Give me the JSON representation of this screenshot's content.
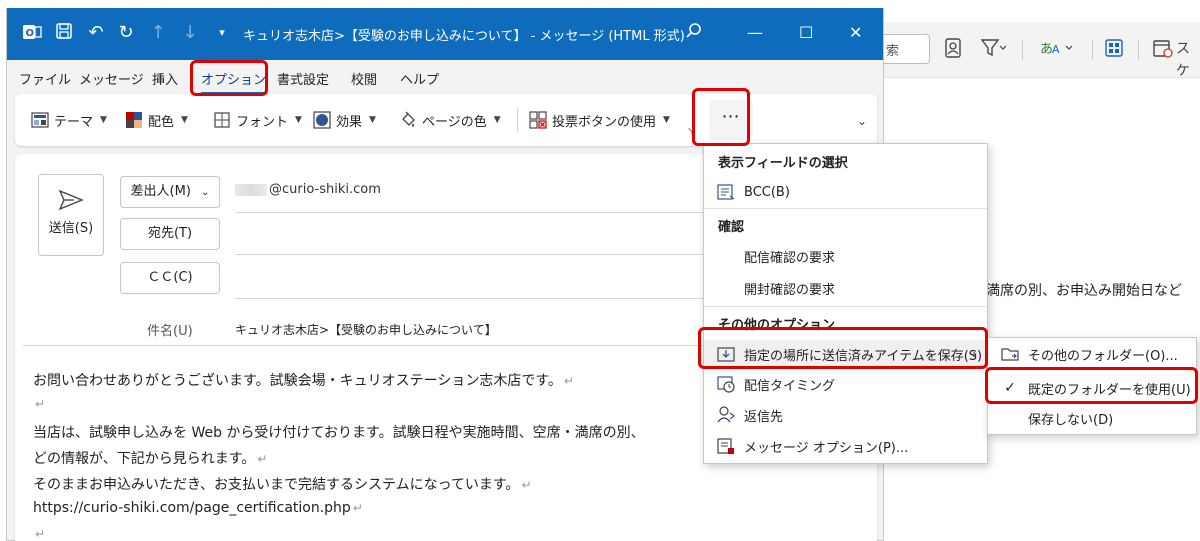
{
  "window": {
    "title": "キュリオ志木店>【受験のお申し込みについて】 - メッセージ (HTML 形式)"
  },
  "menu": {
    "items": [
      "ファイル",
      "メッセージ",
      "挿入",
      "オプション",
      "書式設定",
      "校閲",
      "ヘルプ"
    ],
    "active_index": 3
  },
  "ribbon": {
    "theme": "テーマ",
    "colors": "配色",
    "fonts": "フォント",
    "effects": "効果",
    "page_color": "ページの色",
    "voting": "投票ボタンの使用",
    "more": "⋯"
  },
  "compose": {
    "send": "送信(S)",
    "from_button": "差出人(M)",
    "from_address": "@curio-shiki.com",
    "to_button": "宛先(T)",
    "cc_button": "ＣＣ(C)",
    "subject_label": "件名(U)",
    "subject": "キュリオ志木店>【受験のお申し込みについて】",
    "body": [
      "お問い合わせありがとうございます。試験会場・キュリオステーション志木店です。",
      "",
      "当店は、試験申し込みを Web から受け付けております。試験日程や実施時間、空席・満席の別、",
      "どの情報が、下記から見られます。",
      "そのままお申込みいただき、お支払いまで完結するシステムになっています。",
      "https://curio-shiki.com/page_certification.php",
      ""
    ]
  },
  "background": {
    "search_text": "索",
    "right_label": "スケ",
    "body_text": "満席の別、お申込み開始日など"
  },
  "dropdown": {
    "header_fields": "表示フィールドの選択",
    "bcc": "BCC(B)",
    "header_confirm": "確認",
    "delivery_receipt": "配信確認の要求",
    "read_receipt": "開封確認の要求",
    "header_other": "その他のオプション",
    "save_sent": "指定の場所に送信済みアイテムを保存(S)",
    "delay": "配信タイミング",
    "reply_to": "返信先",
    "msg_options": "メッセージ オプション(P)..."
  },
  "submenu": {
    "other_folder": "その他のフォルダー(O)...",
    "default_folder": "既定のフォルダーを使用(U)",
    "dont_save": "保存しない(D)",
    "checked": "default_folder"
  },
  "colors": {
    "titlebar": "#0f6cbd",
    "highlight": "#e00000"
  }
}
